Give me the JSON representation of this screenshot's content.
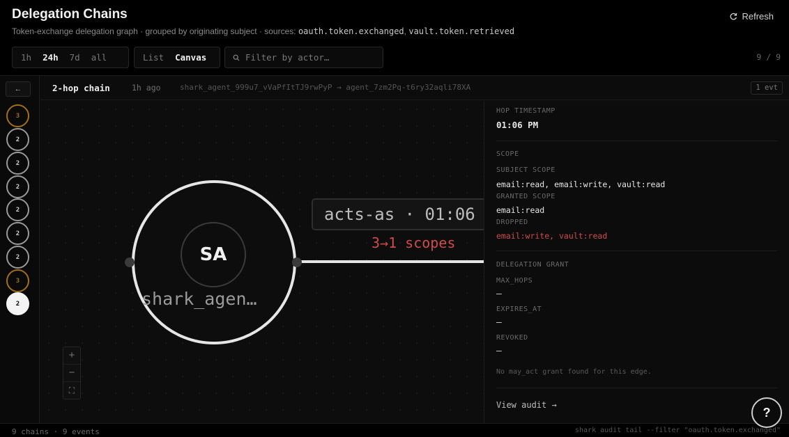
{
  "header": {
    "title": "Delegation Chains",
    "subtitle_prefix": "Token-exchange delegation graph · grouped by originating subject · sources:",
    "source_1": "oauth.token.exchanged",
    "source_sep": ",",
    "source_2": "vault.token.retrieved",
    "refresh_label": "Refresh",
    "refresh_icon": "refresh-icon"
  },
  "controls": {
    "range_options": [
      "1h",
      "24h",
      "7d",
      "all"
    ],
    "range_selected": "24h",
    "view_options": [
      "List",
      "Canvas"
    ],
    "view_selected": "Canvas",
    "filter_placeholder": "Filter by actor…",
    "counter": "9 / 9"
  },
  "rail": {
    "back_label": "←",
    "chains": [
      {
        "hops": "3",
        "state": "warn"
      },
      {
        "hops": "2",
        "state": "normal"
      },
      {
        "hops": "2",
        "state": "normal"
      },
      {
        "hops": "2",
        "state": "normal"
      },
      {
        "hops": "2",
        "state": "normal"
      },
      {
        "hops": "2",
        "state": "normal"
      },
      {
        "hops": "2",
        "state": "normal"
      },
      {
        "hops": "3",
        "state": "warn"
      },
      {
        "hops": "2",
        "state": "active"
      }
    ]
  },
  "crumb": {
    "label": "2-hop chain",
    "ago": "1h ago",
    "path": "shark_agent_999u7_vVaPfItTJ9rwPyP → agent_7zm2Pq-t6ry32aqli78XA",
    "events": "1 evt"
  },
  "canvas": {
    "node_initials": "SA",
    "node_name": "shark_agen…",
    "edge_label": "acts-as · 01:06",
    "edge_scopes": "3→1 scopes",
    "zoom_in": "+",
    "zoom_out": "−",
    "fit": "⛶"
  },
  "panel": {
    "hop_timestamp_label": "HOP TIMESTAMP",
    "hop_timestamp": "01:06 PM",
    "scope_label": "SCOPE",
    "subject_scope_label": "SUBJECT SCOPE",
    "subject_scope": "email:read, email:write, vault:read",
    "granted_scope_label": "GRANTED SCOPE",
    "granted_scope": "email:read",
    "dropped_label": "DROPPED",
    "dropped": "email:write, vault:read",
    "grant_label": "DELEGATION GRANT",
    "max_hops_label": "MAX_HOPS",
    "max_hops": "—",
    "expires_label": "EXPIRES_AT",
    "expires": "—",
    "revoked_label": "REVOKED",
    "revoked": "—",
    "note": "No may_act grant found for this edge.",
    "view_audit": "View audit →"
  },
  "help": "?",
  "footer": {
    "stats": "9 chains · 9 events",
    "cmd": "shark audit tail --filter \"oauth.token.exchanged\""
  },
  "colors": {
    "accent_warn": "#a56e18",
    "dropped_red": "#d24a4a",
    "background": "#000000"
  }
}
